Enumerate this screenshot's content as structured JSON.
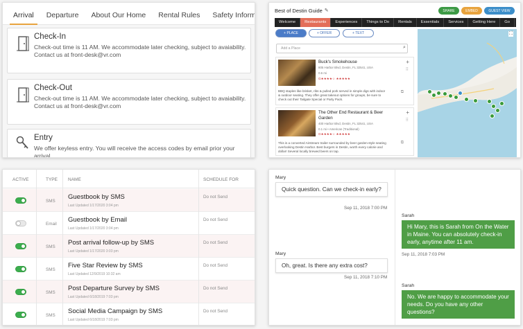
{
  "guide": {
    "tabs": [
      "Arrival",
      "Departure",
      "About Our Home",
      "Rental Rules",
      "Safety Informat"
    ],
    "cards": [
      {
        "title": "Check-In",
        "body": "Check-out time is 11 AM. We accommodate later checking, subject to avaiability. Contact us at front-desk@vr.com",
        "icon": "door-icon"
      },
      {
        "title": "Check-Out",
        "body": "Check-out time is 11 AM. We accommodate later checking, subject to avaiability. Contact us at front-desk@vr.com",
        "icon": "door-icon"
      },
      {
        "title": "Entry",
        "body": "We offer keyless entry. You will receive the access codes by email prior your arrival.",
        "icon": "key-icon"
      }
    ]
  },
  "map_editor": {
    "title": "Best of Destin Guide",
    "buttons": {
      "share": "SHARE",
      "embed": "EMBED",
      "guest_view": "GUEST VIEW"
    },
    "nav": [
      "Welcome",
      "Restaurants",
      "Experiences",
      "Things to Do",
      "Rentals",
      "Essentials",
      "Services",
      "Getting Here",
      "Go"
    ],
    "segments": {
      "place": "+ PLACE",
      "offer": "+ OFFER",
      "text": "+ TEXT"
    },
    "add_place_placeholder": "Add a Place",
    "listings": [
      {
        "name": "Buck's Smokehouse",
        "address": "805 Harbor Blvd, Destin, FL 32541, USA",
        "distance": "0.6 mi",
        "desc": "BBQ staples like brisket, ribs & pulled pork served in simple digs with indoor & outdoor seating. They offer great takeout options for groups, be sure to check out their Tailgate Special or Party Pack."
      },
      {
        "name": "The Other End Restaurant & Beer Garden",
        "address": "400 Harbor Blvd, Destin, FL 32541, USA",
        "distance": "0.1 mi • American (Traditional)",
        "desc": "This is a converted Airstream trailer surrounded by beer garden-style seating overlooking Destin Harbor. Best burgers in Destin, worth every calorie and dollar! Several locally brewed beers on tap."
      }
    ],
    "colors": {
      "share": "#3d9a45",
      "embed": "#e8a33d",
      "guest_view": "#3c8ec9",
      "nav_active": "#e36e59"
    }
  },
  "messages_table": {
    "headers": {
      "active": "ACTIVE",
      "type": "TYPE",
      "name": "NAME",
      "schedule": "SCHEDULE FOR"
    },
    "rows": [
      {
        "active": true,
        "type": "SMS",
        "name": "Guestbook by SMS",
        "updated": "Last Updated 1/17/2020 3:04 pm",
        "schedule": "Do not Send"
      },
      {
        "active": false,
        "type": "Email",
        "name": "Guestbook by Email",
        "updated": "Last Updated 1/17/2020 3:04 pm",
        "schedule": "Do not Send"
      },
      {
        "active": true,
        "type": "SMS",
        "name": "Post arrival follow-up by SMS",
        "updated": "Last Updated 1/17/2020 3:03 pm",
        "schedule": "Do not Send"
      },
      {
        "active": true,
        "type": "SMS",
        "name": "Five Star Review by SMS",
        "updated": "Last Updated 12/9/2019 10:32 am",
        "schedule": "Do not Send"
      },
      {
        "active": true,
        "type": "SMS",
        "name": "Post Departure Survey by SMS",
        "updated": "Last Updated 6/18/2019 7:03 pm",
        "schedule": "Do not Send"
      },
      {
        "active": true,
        "type": "SMS",
        "name": "Social Media Campaign by SMS",
        "updated": "Last Updated 6/18/2019 7:03 pm",
        "schedule": "Do not Send"
      }
    ]
  },
  "chat": {
    "messages": [
      {
        "sender": "Mary",
        "text": "Quick question. Can we check-in early?",
        "time": "Sep 11, 2018 7:00 PM"
      },
      {
        "sender": "Sarah",
        "text": "Hi Mary, this is Sarah from On the Water in Maine. You can absolutely check-in early, anytime after 11 am.",
        "time": "Sep 11, 2018 7:03 PM"
      },
      {
        "sender": "Mary",
        "text": "Oh, great. Is there any extra cost?",
        "time": "Sep 11, 2018 7:10 PM"
      },
      {
        "sender": "Sarah",
        "text": "No. We are happy to accommodate your needs. Do you have any other questions?",
        "time": ""
      }
    ]
  }
}
